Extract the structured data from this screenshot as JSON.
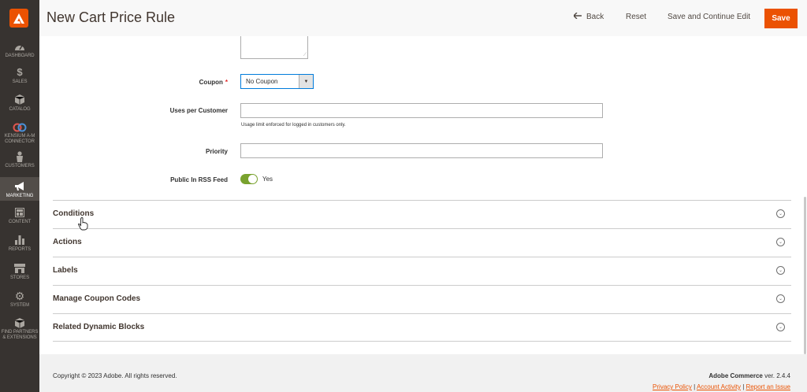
{
  "header": {
    "title": "New Cart Price Rule",
    "back_label": "Back",
    "reset_label": "Reset",
    "save_continue_label": "Save and Continue Edit",
    "save_label": "Save"
  },
  "sidebar": {
    "items": [
      {
        "label": "DASHBOARD",
        "icon": "dashboard-icon"
      },
      {
        "label": "SALES",
        "icon": "dollar-icon"
      },
      {
        "label": "CATALOG",
        "icon": "cube-icon"
      },
      {
        "label": "KENSIUM A-M",
        "label2": "CONNECTOR",
        "icon": "connector-icon"
      },
      {
        "label": "CUSTOMERS",
        "icon": "person-icon"
      },
      {
        "label": "MARKETING",
        "icon": "megaphone-icon"
      },
      {
        "label": "CONTENT",
        "icon": "layout-icon"
      },
      {
        "label": "REPORTS",
        "icon": "bar-chart-icon"
      },
      {
        "label": "STORES",
        "icon": "store-icon"
      },
      {
        "label": "SYSTEM",
        "icon": "gear-icon"
      },
      {
        "label": "FIND PARTNERS",
        "label2": "& EXTENSIONS",
        "icon": "extensions-icon"
      }
    ],
    "active": "MARKETING"
  },
  "form": {
    "coupon_label": "Coupon",
    "coupon_required": "*",
    "coupon_value": "No Coupon",
    "uses_per_customer_label": "Uses per Customer",
    "uses_per_customer_value": "",
    "uses_note": "Usage limit enforced for logged in customers only.",
    "priority_label": "Priority",
    "priority_value": "",
    "rss_label": "Public In RSS Feed",
    "rss_value": "Yes"
  },
  "sections": [
    {
      "title": "Conditions"
    },
    {
      "title": "Actions"
    },
    {
      "title": "Labels"
    },
    {
      "title": "Manage Coupon Codes"
    },
    {
      "title": "Related Dynamic Blocks"
    }
  ],
  "footer": {
    "copyright": "Copyright © 2023 Adobe. All rights reserved.",
    "product_name": "Adobe Commerce",
    "version": "ver. 2.4.4",
    "links": [
      "Privacy Policy",
      "Account Activity",
      "Report an Issue"
    ],
    "separator": "|"
  },
  "colors": {
    "accent": "#eb5202",
    "sidebar": "#373330",
    "toggle_on": "#79a22e",
    "focus": "#007bdb"
  }
}
